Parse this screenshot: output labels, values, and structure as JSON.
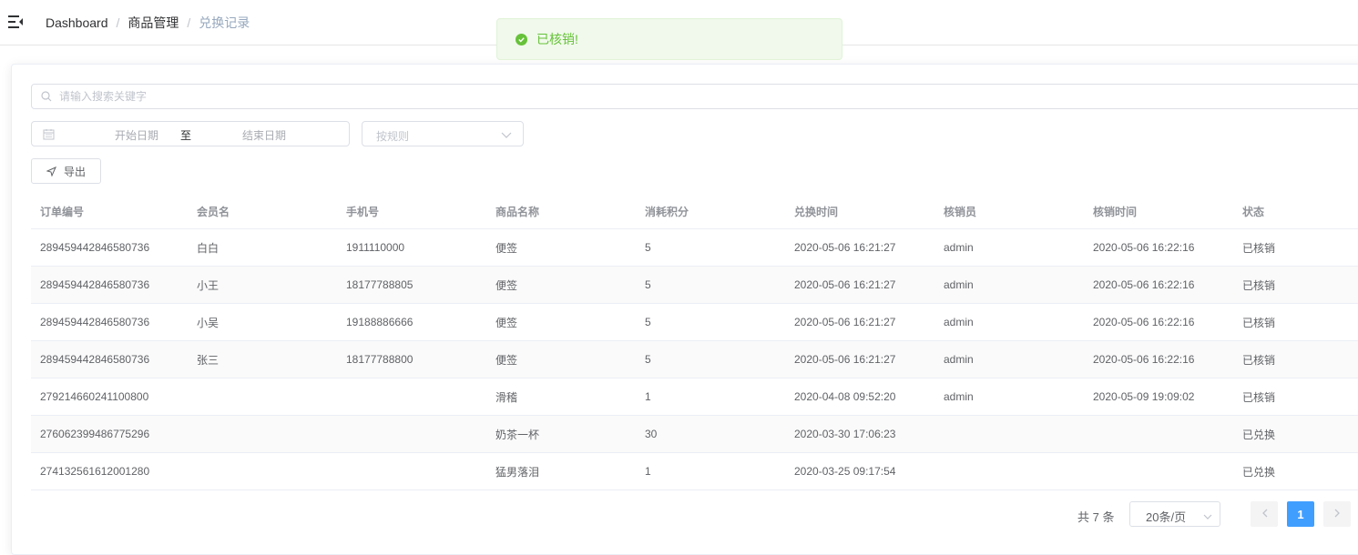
{
  "breadcrumb": {
    "items": [
      "Dashboard",
      "商品管理",
      "兑换记录"
    ],
    "separator": "/"
  },
  "toast": {
    "message": "已核销!",
    "type": "success"
  },
  "filters": {
    "search_placeholder": "请输入搜索关键字",
    "start_date_placeholder": "开始日期",
    "range_separator": "至",
    "end_date_placeholder": "结束日期",
    "rule_placeholder": "按规则"
  },
  "toolbar": {
    "export_label": "导出"
  },
  "table": {
    "columns": [
      "订单编号",
      "会员名",
      "手机号",
      "商品名称",
      "消耗积分",
      "兑换时间",
      "核销员",
      "核销时间",
      "状态"
    ],
    "rows": [
      [
        "289459442846580736",
        "白白",
        "1911110000",
        "便签",
        "5",
        "2020-05-06 16:21:27",
        "admin",
        "2020-05-06 16:22:16",
        "已核销"
      ],
      [
        "289459442846580736",
        "小王",
        "18177788805",
        "便签",
        "5",
        "2020-05-06 16:21:27",
        "admin",
        "2020-05-06 16:22:16",
        "已核销"
      ],
      [
        "289459442846580736",
        "小吴",
        "19188886666",
        "便签",
        "5",
        "2020-05-06 16:21:27",
        "admin",
        "2020-05-06 16:22:16",
        "已核销"
      ],
      [
        "289459442846580736",
        "张三",
        "18177788800",
        "便签",
        "5",
        "2020-05-06 16:21:27",
        "admin",
        "2020-05-06 16:22:16",
        "已核销"
      ],
      [
        "279214660241100800",
        "",
        "",
        "滑稽",
        "1",
        "2020-04-08 09:52:20",
        "admin",
        "2020-05-09 19:09:02",
        "已核销"
      ],
      [
        "276062399486775296",
        "",
        "",
        "奶茶一杯",
        "30",
        "2020-03-30 17:06:23",
        "",
        "",
        "已兑换"
      ],
      [
        "274132561612001280",
        "",
        "",
        "猛男落泪",
        "1",
        "2020-03-25 09:17:54",
        "",
        "",
        "已兑换"
      ]
    ]
  },
  "pagination": {
    "total_label": "共 7 条",
    "page_size_label": "20条/页",
    "current_page": "1"
  },
  "colors": {
    "primary": "#409eff",
    "success": "#67c23a",
    "success_bg": "#f0f9eb",
    "border": "#dcdfe6"
  }
}
